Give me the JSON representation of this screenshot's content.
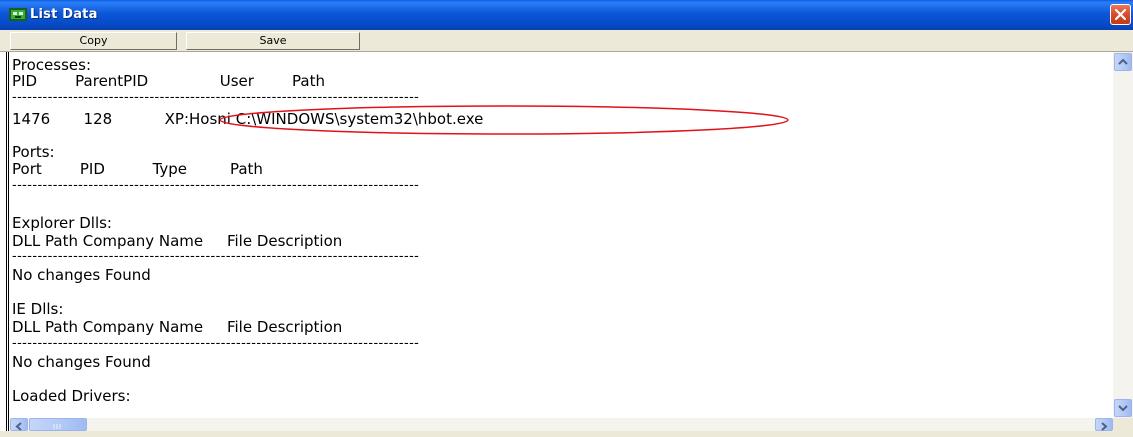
{
  "window": {
    "title": "List Data"
  },
  "toolbar": {
    "copy_label": "Copy",
    "save_label": "Save"
  },
  "content": {
    "processes_heading": "Processes:",
    "processes_header": "PID        ParentPID               User        Path",
    "processes_dashes": "--------------------------------------------------------------------------------",
    "process_row": "1476       128           XP:Hosni C:\\WINDOWS\\system32\\hbot.exe",
    "ports_heading": "Ports:",
    "ports_header": "Port        PID          Type         Path",
    "ports_dashes": "--------------------------------------------------------------------------------",
    "explorer_heading": "Explorer Dlls:",
    "explorer_header": "DLL Path Company Name     File Description",
    "explorer_dashes": "--------------------------------------------------------------------------------",
    "explorer_result": "No changes Found",
    "ie_heading": "IE Dlls:",
    "ie_header": "DLL Path Company Name     File Description",
    "ie_dashes": "--------------------------------------------------------------------------------",
    "ie_result": "No changes Found",
    "drivers_heading": "Loaded Drivers:"
  },
  "colors": {
    "titlebar": "#0a57d8",
    "highlight_ellipse": "#e0131a",
    "close_button": "#d94b2a"
  },
  "icons": {
    "app": "green-network-icon",
    "close": "close-icon",
    "scroll_up": "chevron-up-icon",
    "scroll_down": "chevron-down-icon",
    "scroll_left": "chevron-left-icon",
    "scroll_right": "chevron-right-icon"
  }
}
